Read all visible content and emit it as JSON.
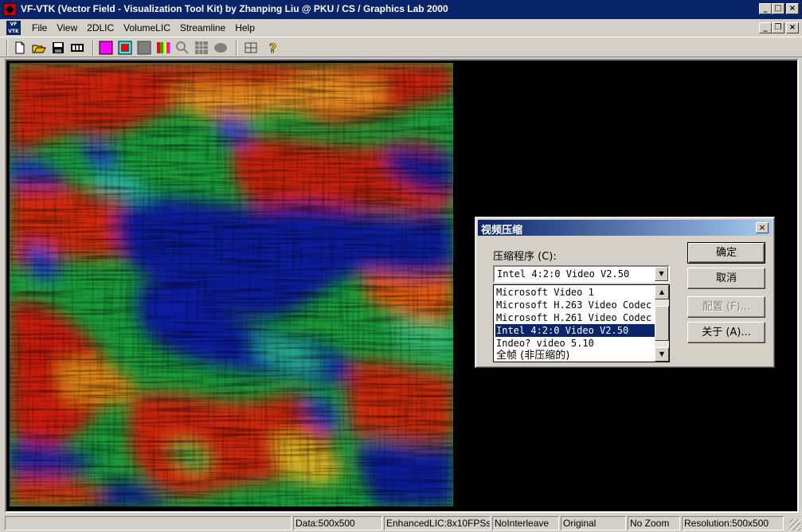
{
  "window": {
    "title": "VF-VTK (Vector Field - Visualization Tool Kit) by Zhanping Liu @ PKU / CS / Graphics Lab 2000",
    "app_icon": "vf-vtk-icon",
    "doc_icon_text": "VF VTK"
  },
  "menu": [
    "File",
    "View",
    "2DLIC",
    "VolumeLIC",
    "Streamline",
    "Help"
  ],
  "toolbar": [
    "new-icon",
    "open-icon",
    "save-icon",
    "film-icon",
    "magenta-square-icon",
    "red-cyan-square-icon",
    "gray-square-icon",
    "color-bars-icon",
    "zoom-icon",
    "grid-icon",
    "blob-icon",
    "layout-icon",
    "help-icon"
  ],
  "dialog": {
    "title": "视频压缩",
    "label": "压缩程序 (C):",
    "selected": "Intel 4:2:0 Video V2.50",
    "list": [
      "Microsoft Video 1",
      "Microsoft H.263 Video Codec",
      "Microsoft H.261 Video Codec",
      "Intel 4:2:0 Video V2.50",
      "Indeo? video 5.10",
      "全帧 (非压缩的)"
    ],
    "selected_index": 3,
    "buttons": {
      "ok": "确定",
      "cancel": "取消",
      "configure": "配置 (F)...",
      "about": "关于 (A)..."
    }
  },
  "status": {
    "data": "Data:500x500",
    "mode": "EnhancedLIC:8x10FPSs",
    "interleave": "NoInterleave",
    "view": "Original",
    "zoom": "No Zoom",
    "resolution": "Resolution:500x500"
  }
}
